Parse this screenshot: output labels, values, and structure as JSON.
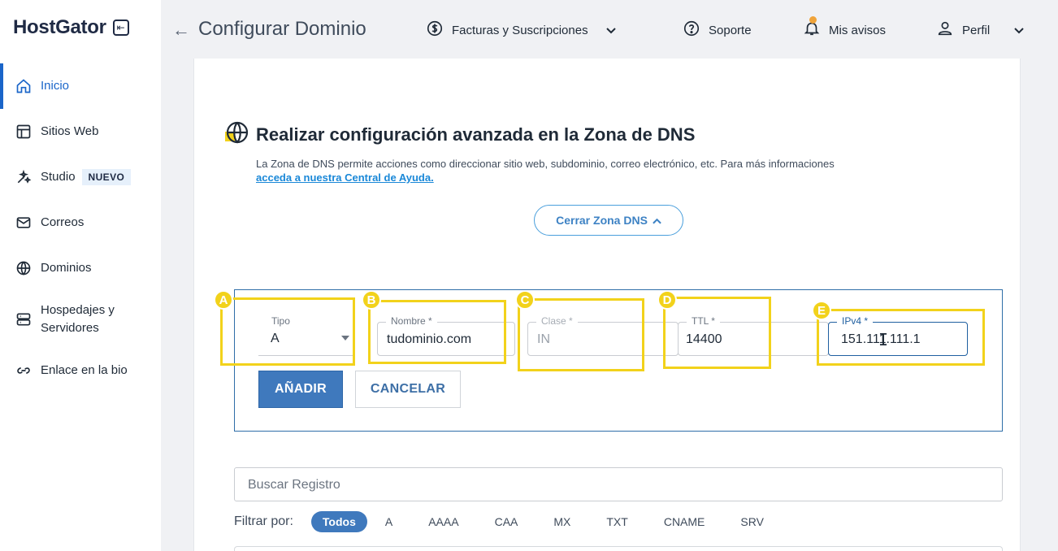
{
  "app": {
    "logo": "HostGator"
  },
  "sidebar": {
    "items": [
      {
        "label": "Inicio",
        "icon": "home-icon",
        "active": true
      },
      {
        "label": "Sitios Web",
        "icon": "layout-icon"
      },
      {
        "label": "Studio",
        "icon": "magic-wand-icon",
        "badge": "NUEVO"
      },
      {
        "label": "Correos",
        "icon": "mail-icon"
      },
      {
        "label": "Dominios",
        "icon": "globe-icon"
      },
      {
        "label": "Hospedajes y Servidores",
        "icon": "server-icon"
      },
      {
        "label": "Enlace en la bio",
        "icon": "link-icon"
      }
    ]
  },
  "header": {
    "title": "Configurar Dominio",
    "billing": "Facturas y Suscripciones",
    "support": "Soporte",
    "notices": "Mis avisos",
    "notices_count": "1",
    "profile": "Perfil"
  },
  "dns": {
    "title": "Realizar configuración avanzada en la Zona de DNS",
    "description": "La Zona de DNS permite acciones como direccionar sitio web, subdominio, correo electrónico, etc. Para más informaciones",
    "help_link": "acceda a nuestra Central de Ayuda.",
    "close_button": "Cerrar Zona DNS"
  },
  "form": {
    "tipo_label": "Tipo",
    "tipo_value": "A",
    "nombre_label": "Nombre *",
    "nombre_value": "tudominio.com",
    "clase_label": "Clase *",
    "clase_value": "IN",
    "ttl_label": "TTL *",
    "ttl_value": "14400",
    "ipv4_label": "IPv4 *",
    "ipv4_value": "151.111.111.1",
    "add_button": "AÑADIR",
    "cancel_button": "CANCELAR"
  },
  "annotations": [
    "A",
    "B",
    "C",
    "D",
    "E"
  ],
  "annotation_color": "#f2d21b",
  "search": {
    "placeholder": "Buscar Registro"
  },
  "filters": {
    "label": "Filtrar por:",
    "options": [
      "Todos",
      "A",
      "AAAA",
      "CAA",
      "MX",
      "TXT",
      "CNAME",
      "SRV"
    ],
    "selected": "Todos"
  },
  "colors": {
    "accent": "#1a65c9",
    "primary_button": "#3f79bd",
    "link": "#1a88d8"
  }
}
